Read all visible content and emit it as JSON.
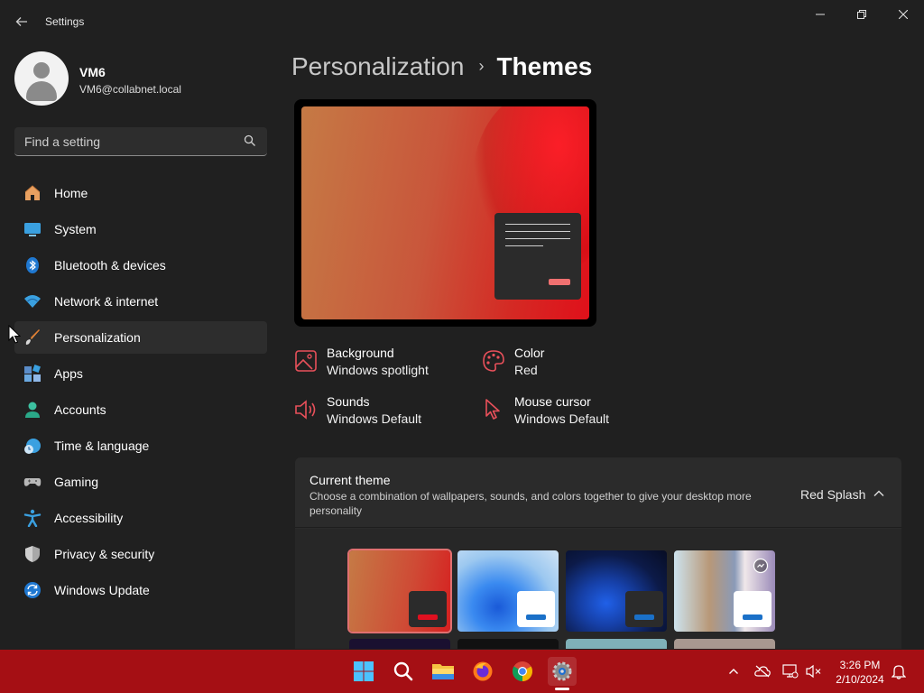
{
  "window": {
    "title": "Settings",
    "controls": [
      "minimize",
      "maximize",
      "close"
    ]
  },
  "profile": {
    "name": "VM6",
    "email": "VM6@collabnet.local"
  },
  "search": {
    "placeholder": "Find a setting"
  },
  "sidebar": {
    "items": [
      {
        "label": "Home",
        "icon": "home-icon"
      },
      {
        "label": "System",
        "icon": "system-icon"
      },
      {
        "label": "Bluetooth & devices",
        "icon": "bluetooth-icon"
      },
      {
        "label": "Network & internet",
        "icon": "wifi-icon"
      },
      {
        "label": "Personalization",
        "icon": "brush-icon",
        "active": true
      },
      {
        "label": "Apps",
        "icon": "apps-icon"
      },
      {
        "label": "Accounts",
        "icon": "accounts-icon"
      },
      {
        "label": "Time & language",
        "icon": "time-language-icon"
      },
      {
        "label": "Gaming",
        "icon": "gaming-icon"
      },
      {
        "label": "Accessibility",
        "icon": "accessibility-icon"
      },
      {
        "label": "Privacy & security",
        "icon": "shield-icon"
      },
      {
        "label": "Windows Update",
        "icon": "update-icon"
      }
    ]
  },
  "breadcrumb": {
    "parent": "Personalization",
    "separator": "›",
    "current": "Themes"
  },
  "properties": {
    "background": {
      "title": "Background",
      "value": "Windows spotlight"
    },
    "color": {
      "title": "Color",
      "value": "Red"
    },
    "sounds": {
      "title": "Sounds",
      "value": "Windows Default"
    },
    "cursor": {
      "title": "Mouse cursor",
      "value": "Windows Default"
    }
  },
  "current_theme": {
    "title": "Current theme",
    "description": "Choose a combination of wallpapers, sounds, and colors together to give your desktop more personality",
    "value": "Red Splash"
  },
  "themes": [
    {
      "name": "red-splash",
      "selected": true
    },
    {
      "name": "windows-light"
    },
    {
      "name": "windows-dark"
    },
    {
      "name": "windows-spotlight"
    }
  ],
  "taskbar": {
    "apps": [
      "start-icon",
      "search-icon",
      "file-explorer-icon",
      "firefox-icon",
      "chrome-icon",
      "settings-icon"
    ],
    "time": "3:26 PM",
    "date": "2/10/2024"
  },
  "colors": {
    "accent": "#e81123",
    "taskbar": "#a50f14",
    "window_bg": "#202020"
  }
}
